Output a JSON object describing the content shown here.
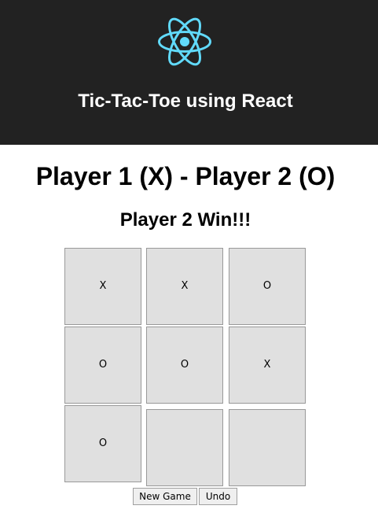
{
  "header": {
    "logo_icon": "react-logo-icon",
    "logo_color": "#61dafb",
    "title": "Tic-Tac-Toe using React"
  },
  "game": {
    "players_heading": "Player 1 (X) - Player 2 (O)",
    "status": "Player 2 Win!!!",
    "board": [
      "X",
      "X",
      "O",
      "O",
      "O",
      "X",
      "O",
      "",
      ""
    ]
  },
  "controls": {
    "new_game_label": "New Game",
    "undo_label": "Undo"
  }
}
